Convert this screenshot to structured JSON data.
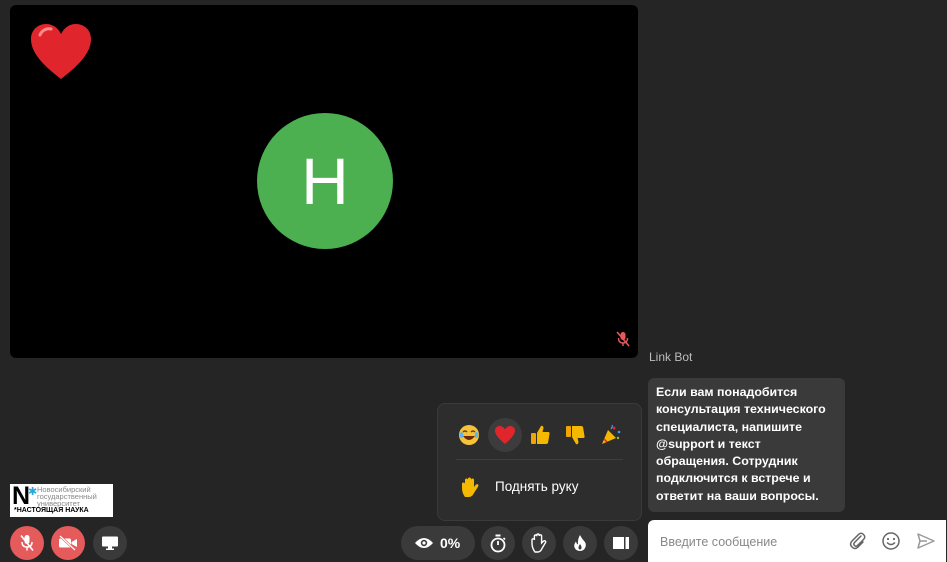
{
  "video": {
    "participant_initial": "H",
    "avatar_color": "#4caf50",
    "active_reaction": "heart-icon",
    "mic_muted_icon": "mic-off-icon"
  },
  "chat": {
    "sender": "Link Bot",
    "message": "Если вам понадобится консультация технического специалиста, напишите @support и текст обращения. Сотрудник подключится к встрече и ответит на ваши вопросы.",
    "input_placeholder": "Введите сообщение",
    "icons": [
      "paperclip-icon",
      "smile-icon",
      "send-icon"
    ]
  },
  "reactions_popup": {
    "emojis": [
      "laugh-emoji",
      "heart-emoji",
      "thumbs-up-emoji",
      "thumbs-down-emoji",
      "party-emoji"
    ],
    "selected": "heart-emoji",
    "raise_hand_label": "Поднять руку"
  },
  "logo": {
    "letter": "N",
    "lines": [
      "Новосибирский",
      "государственный",
      "университет"
    ],
    "tagline": "*НАСТОЯЩАЯ НАУКА"
  },
  "controls": {
    "left": [
      "mic-off-button",
      "camera-off-button",
      "screen-share-button"
    ],
    "views_percent": "0%",
    "right": [
      "timer-button",
      "raise-hand-button",
      "fire-button",
      "layout-button"
    ]
  },
  "colors": {
    "background": "#252525",
    "danger": "#e55a5a",
    "control_bg": "#3a3a3a",
    "bubble_bg": "#3a3a3a"
  }
}
